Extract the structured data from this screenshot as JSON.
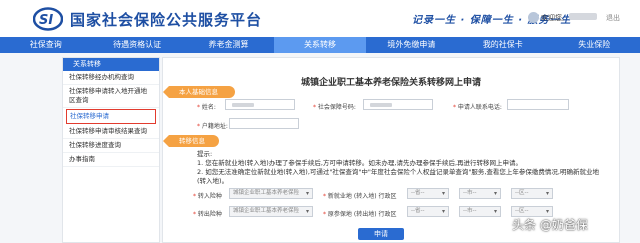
{
  "header": {
    "site_title": "国家社会保险公共服务平台",
    "slogan": "记录一生 · 保障一生 · 服务一生",
    "welcome": "欢迎您,",
    "logout": "退出"
  },
  "nav": {
    "items": [
      {
        "label": "社保查询"
      },
      {
        "label": "待遇资格认证"
      },
      {
        "label": "养老金测算"
      },
      {
        "label": "关系转移"
      },
      {
        "label": "境外免缴申请"
      },
      {
        "label": "我的社保卡"
      },
      {
        "label": "失业保险"
      }
    ],
    "active_index": 3
  },
  "sidebar": {
    "heading": "关系转移",
    "items": [
      {
        "label": "社保转移经办机构查询"
      },
      {
        "label": "社保转移申请转入地开通地区查询"
      },
      {
        "label": "社保转移申请"
      },
      {
        "label": "社保转移申请审核结果查询"
      },
      {
        "label": "社保转移进度查询"
      },
      {
        "label": "办事指南"
      }
    ],
    "active_index": 2
  },
  "form": {
    "title": "城镇企业职工基本养老保险关系转移网上申请",
    "section_personal": "本人基础信息",
    "section_transfer": "转移信息",
    "labels": {
      "name": "姓名:",
      "ss_number": "社会保障号码:",
      "phone": "申请人联系电话:",
      "household_address": "户籍地址:",
      "transfer_in_type": "转入险种",
      "new_location": "新就业地",
      "transfer_out_type": "转出险种",
      "original_location": "原参保地"
    },
    "placeholders": {
      "insurance_type": "城镇企业职工基本养老保险",
      "region": "--请选择--",
      "province": "--省--",
      "city": "--市--",
      "district": "--区--"
    },
    "sub_labels": {
      "new_location_district": "(转入地) 行政区",
      "original_location_district": "(转出地) 行政区"
    },
    "tips": {
      "heading": "提示:",
      "line1": "1. 您在新就业地(转入地)办理了参保手续后,方可申请转移。如未办理,请先办理参保手续后,再进行转移网上申请。",
      "line2": "2. 如您无法准确定位新就业地(转入地),可通过\"社保查询\"中\"年度社会保险个人权益记录单查询\"服务,查看您上年参保缴费情况,明确新就业地(转入地)。"
    },
    "submit_label": "申请"
  },
  "watermark": "头条 @奶爸保",
  "colors": {
    "brand_blue": "#2a6bd1",
    "title_blue": "#1e4fa3",
    "section_orange": "#f5a243",
    "highlight_red": "#e23b2e"
  }
}
